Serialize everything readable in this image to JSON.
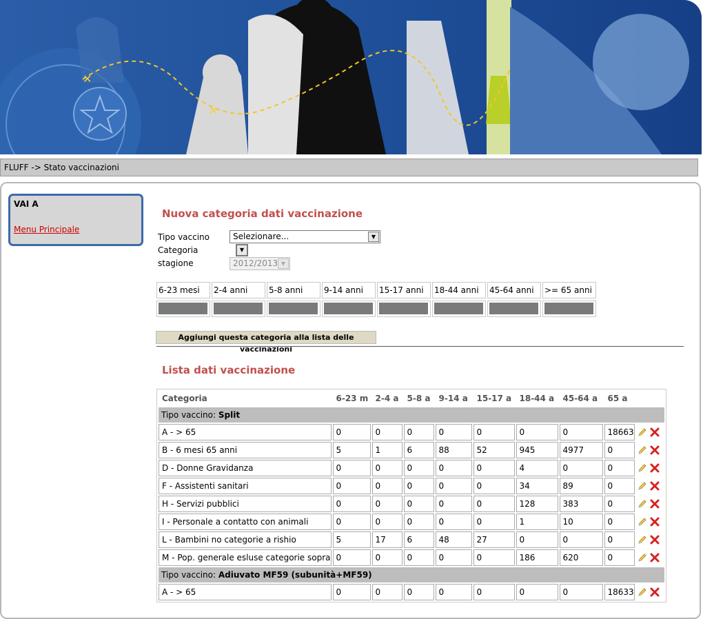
{
  "breadcrumb": "FLUFF -> Stato vaccinazioni",
  "sidebar": {
    "title": "VAI A",
    "link": "Menu Principale"
  },
  "form": {
    "title": "Nuova categoria dati vaccinazione",
    "tipo_label": "Tipo vaccino",
    "tipo_value": "Selezionare...",
    "categoria_label": "Categoria",
    "stagione_label": "stagione",
    "stagione_value": "2012/2013",
    "age_groups": [
      "6-23 mesi",
      "2-4 anni",
      "5-8 anni",
      "9-14 anni",
      "15-17 anni",
      "18-44 anni",
      "45-64 anni",
      ">= 65 anni"
    ],
    "add_button": "Aggiungi questa categoria alla lista delle vaccinazioni"
  },
  "list": {
    "title": "Lista dati vaccinazione",
    "columns": [
      "Categoria",
      "6-23 m",
      "2-4 a",
      "5-8 a",
      "9-14 a",
      "15-17 a",
      "18-44 a",
      "45-64 a",
      "65 a"
    ],
    "groups": [
      {
        "prefix": "Tipo vaccino: ",
        "name": "Split",
        "rows": [
          {
            "cat": "A - > 65",
            "vals": [
              "0",
              "0",
              "0",
              "0",
              "0",
              "0",
              "0",
              "18663"
            ]
          },
          {
            "cat": "B - 6 mesi 65 anni",
            "vals": [
              "5",
              "1",
              "6",
              "88",
              "52",
              "945",
              "4977",
              "0"
            ]
          },
          {
            "cat": "D - Donne Gravidanza",
            "vals": [
              "0",
              "0",
              "0",
              "0",
              "0",
              "4",
              "0",
              "0"
            ]
          },
          {
            "cat": "F - Assistenti sanitari",
            "vals": [
              "0",
              "0",
              "0",
              "0",
              "0",
              "34",
              "89",
              "0"
            ]
          },
          {
            "cat": "H - Servizi pubblici",
            "vals": [
              "0",
              "0",
              "0",
              "0",
              "0",
              "128",
              "383",
              "0"
            ]
          },
          {
            "cat": "I - Personale a contatto con animali",
            "vals": [
              "0",
              "0",
              "0",
              "0",
              "0",
              "1",
              "10",
              "0"
            ]
          },
          {
            "cat": "L - Bambini no categorie a rishio",
            "vals": [
              "5",
              "17",
              "6",
              "48",
              "27",
              "0",
              "0",
              "0"
            ]
          },
          {
            "cat": "M - Pop. generale esluse categorie sopra",
            "vals": [
              "0",
              "0",
              "0",
              "0",
              "0",
              "186",
              "620",
              "0"
            ]
          }
        ]
      },
      {
        "prefix": "Tipo vaccino: ",
        "name": "Adiuvato MF59 (subunità+MF59)",
        "rows": [
          {
            "cat": "A - > 65",
            "vals": [
              "0",
              "0",
              "0",
              "0",
              "0",
              "0",
              "0",
              "18633"
            ]
          }
        ]
      }
    ]
  },
  "colors": {
    "title": "#c0504d",
    "link": "#cc0000",
    "frame": "#3b6aa8"
  }
}
